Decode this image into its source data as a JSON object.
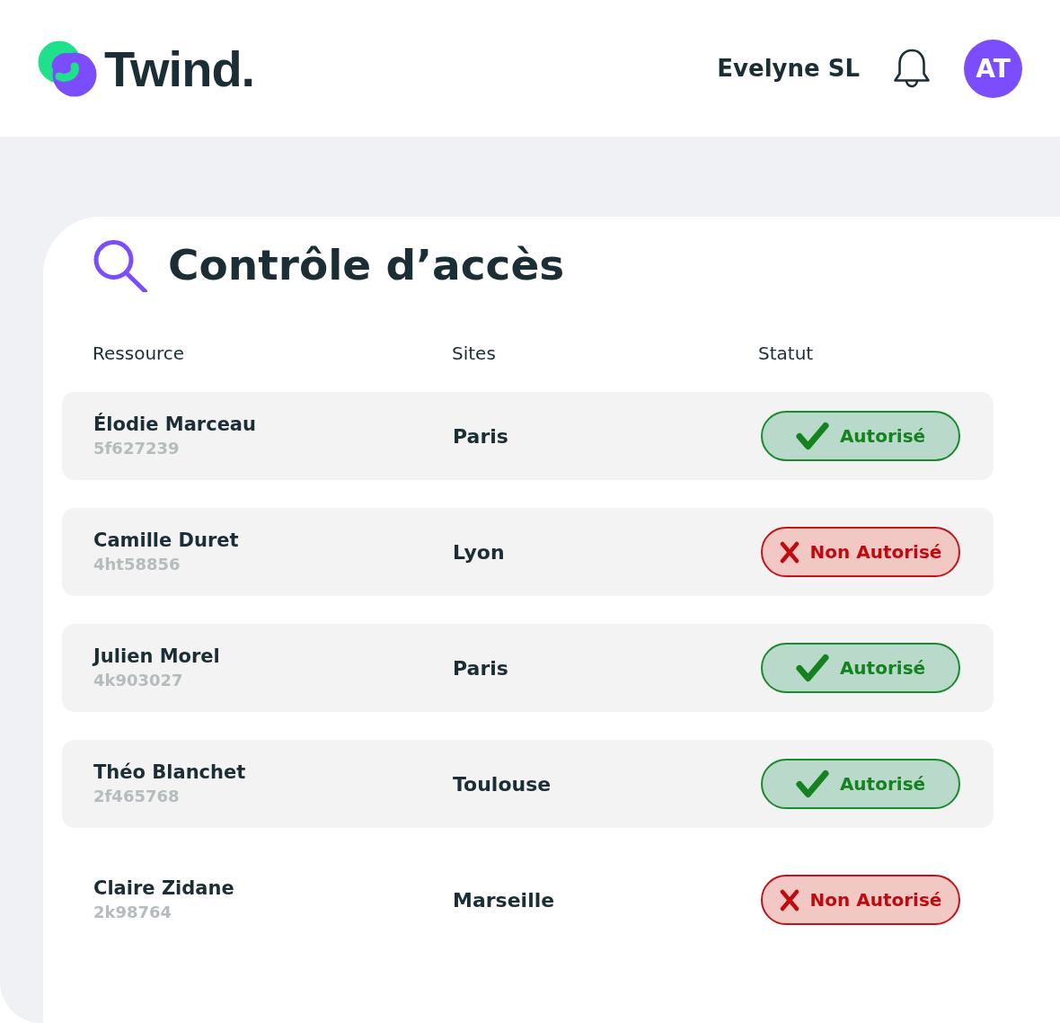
{
  "header": {
    "logo_text": "Twind.",
    "user_name": "Evelyne SL",
    "avatar_initials": "AT"
  },
  "panel": {
    "title": "Contrôle d’accès",
    "table": {
      "columns": [
        "Ressource",
        "Sites",
        "Statut"
      ],
      "rows": [
        {
          "name": "Élodie Marceau",
          "id": "5f627239",
          "site": "Paris",
          "status": {
            "kind": "authorized",
            "label": "Autorisé"
          },
          "shaded": true
        },
        {
          "name": "Camille Duret",
          "id": "4ht58856",
          "site": "Lyon",
          "status": {
            "kind": "denied",
            "label": "Non Autorisé"
          },
          "shaded": true
        },
        {
          "name": "Julien Morel",
          "id": "4k903027",
          "site": "Paris",
          "status": {
            "kind": "authorized",
            "label": "Autorisé"
          },
          "shaded": true
        },
        {
          "name": "Théo Blanchet",
          "id": "2f465768",
          "site": "Toulouse",
          "status": {
            "kind": "authorized",
            "label": "Autorisé"
          },
          "shaded": true
        },
        {
          "name": "Claire Zidane",
          "id": "2k98764",
          "site": "Marseille",
          "status": {
            "kind": "denied",
            "label": "Non Autorisé"
          },
          "shaded": false
        }
      ]
    }
  }
}
